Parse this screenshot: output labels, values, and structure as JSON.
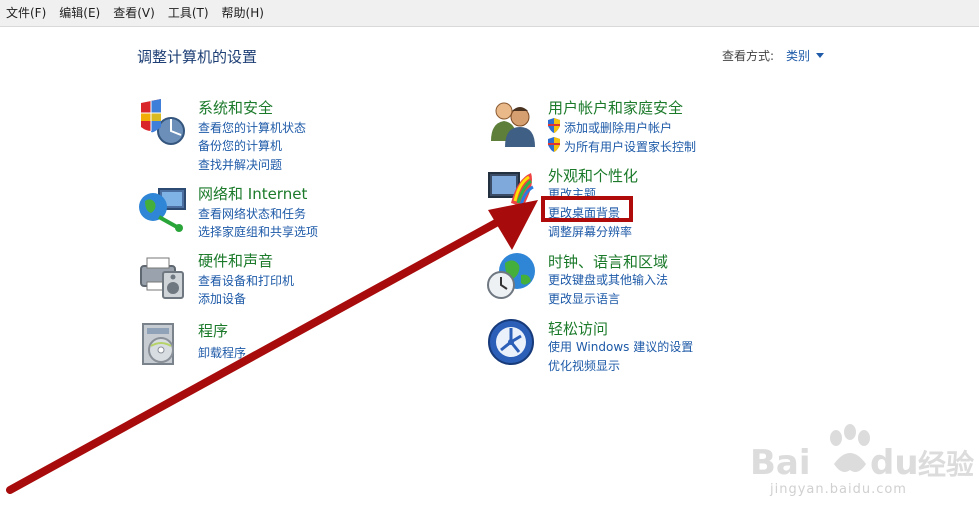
{
  "menu": [
    "文件(F)",
    "编辑(E)",
    "查看(V)",
    "工具(T)",
    "帮助(H)"
  ],
  "page_title": "调整计算机的设置",
  "view_by": {
    "label": "查看方式:",
    "value": "类别"
  },
  "categories": {
    "system": {
      "title": "系统和安全",
      "icon": "shield-system-icon",
      "links": [
        "查看您的计算机状态",
        "备份您的计算机",
        "查找并解决问题"
      ]
    },
    "network": {
      "title": "网络和 Internet",
      "icon": "network-globe-icon",
      "links": [
        "查看网络状态和任务",
        "选择家庭组和共享选项"
      ]
    },
    "hardware": {
      "title": "硬件和声音",
      "icon": "printer-speaker-icon",
      "links": [
        "查看设备和打印机",
        "添加设备"
      ]
    },
    "programs": {
      "title": "程序",
      "icon": "programs-disc-icon",
      "links": [
        "卸载程序"
      ]
    },
    "users": {
      "title": "用户帐户和家庭安全",
      "icon": "users-icon",
      "links": [
        "添加或删除用户帐户",
        "为所有用户设置家长控制"
      ]
    },
    "appearance": {
      "title": "外观和个性化",
      "icon": "monitor-palette-icon",
      "links": [
        "更改主题",
        "更改桌面背景",
        "调整屏幕分辨率"
      ]
    },
    "clock": {
      "title": "时钟、语言和区域",
      "icon": "clock-globe-icon",
      "links": [
        "更改键盘或其他输入法",
        "更改显示语言"
      ]
    },
    "ease": {
      "title": "轻松访问",
      "icon": "ease-of-access-icon",
      "links": [
        "使用 Windows 建议的设置",
        "优化视频显示"
      ]
    }
  },
  "watermark": {
    "brand": "Bai du 经验",
    "url": "jingyan.baidu.com"
  },
  "colors": {
    "link": "#1e5aa8",
    "category_title": "#1b7a2a",
    "highlight": "#b00b0b"
  }
}
